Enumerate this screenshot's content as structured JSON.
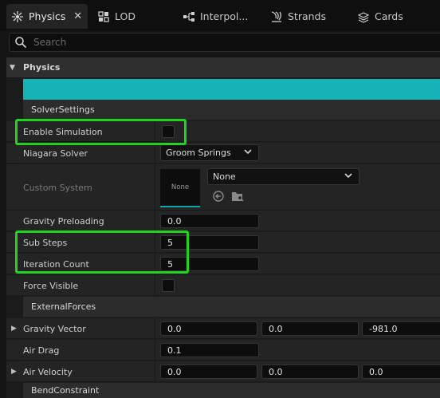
{
  "tabs": [
    {
      "label": "Physics",
      "icon": "physics-icon",
      "active": true
    },
    {
      "label": "LOD",
      "icon": "lod-icon",
      "active": false
    },
    {
      "label": "Interpol...",
      "icon": "interpolation-icon",
      "active": false
    },
    {
      "label": "Strands",
      "icon": "strands-icon",
      "active": false
    },
    {
      "label": "Cards",
      "icon": "cards-icon",
      "active": false
    }
  ],
  "tab_close": "✕",
  "search": {
    "placeholder": "Search"
  },
  "category": {
    "label": "Physics"
  },
  "accent_color": "#14b3b8",
  "highlight_color": "#21d21f",
  "sections": {
    "solver_settings": "SolverSettings",
    "external_forces": "ExternalForces",
    "bend_constraint": "BendConstraint"
  },
  "solver": {
    "enable_simulation_label": "Enable Simulation",
    "enable_simulation_checked": false,
    "niagara_solver_label": "Niagara Solver",
    "niagara_solver_value": "Groom Springs",
    "custom_system_label": "Custom System",
    "custom_system_value": "None",
    "custom_system_thumb": "None",
    "gravity_preloading_label": "Gravity Preloading",
    "gravity_preloading_value": "0.0",
    "sub_steps_label": "Sub Steps",
    "sub_steps_value": "5",
    "iteration_count_label": "Iteration Count",
    "iteration_count_value": "5",
    "force_visible_label": "Force Visible",
    "force_visible_checked": false
  },
  "external": {
    "gravity_vector_label": "Gravity Vector",
    "gravity_vector": [
      "0.0",
      "0.0",
      "-981.0"
    ],
    "air_drag_label": "Air Drag",
    "air_drag_value": "0.1",
    "air_velocity_label": "Air Velocity",
    "air_velocity": [
      "0.0",
      "0.0",
      "0.0"
    ]
  }
}
